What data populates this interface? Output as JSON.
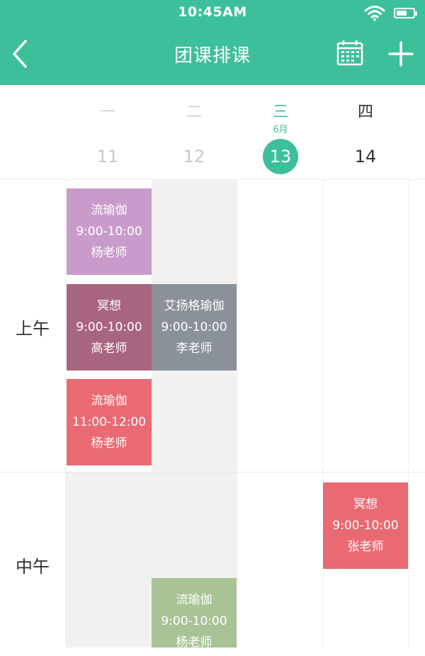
{
  "status_bar": {
    "time": "10:45AM"
  },
  "nav": {
    "title": "团课排课",
    "back_icon": "chevron-left-icon",
    "calendar_icon": "calendar-icon",
    "add_icon": "plus-icon"
  },
  "colors": {
    "accent": "#3ebf9c",
    "purple": "#c99bcb",
    "plum": "#a8657f",
    "gray": "#8a9199",
    "red": "#ea6a74",
    "green": "#a8c496"
  },
  "days": [
    {
      "weekday": "一",
      "date": "11"
    },
    {
      "weekday": "二",
      "date": "12"
    },
    {
      "weekday": "三",
      "month": "6月",
      "date": "13"
    },
    {
      "weekday": "四",
      "date": "14"
    }
  ],
  "periods": {
    "morning": "上午",
    "noon": "中午"
  },
  "courses": [
    {
      "name": "流瑜伽",
      "time": "9:00-10:00",
      "teacher": "杨老师"
    },
    {
      "name": "冥想",
      "time": "9:00-10:00",
      "teacher": "高老师"
    },
    {
      "name": "艾扬格瑜伽",
      "time": "9:00-10:00",
      "teacher": "李老师"
    },
    {
      "name": "流瑜伽",
      "time": "11:00-12:00",
      "teacher": "杨老师"
    },
    {
      "name": "冥想",
      "time": "9:00-10:00",
      "teacher": "张老师"
    },
    {
      "name": "流瑜伽",
      "time": "9:00-10:00",
      "teacher": "杨老师"
    }
  ]
}
